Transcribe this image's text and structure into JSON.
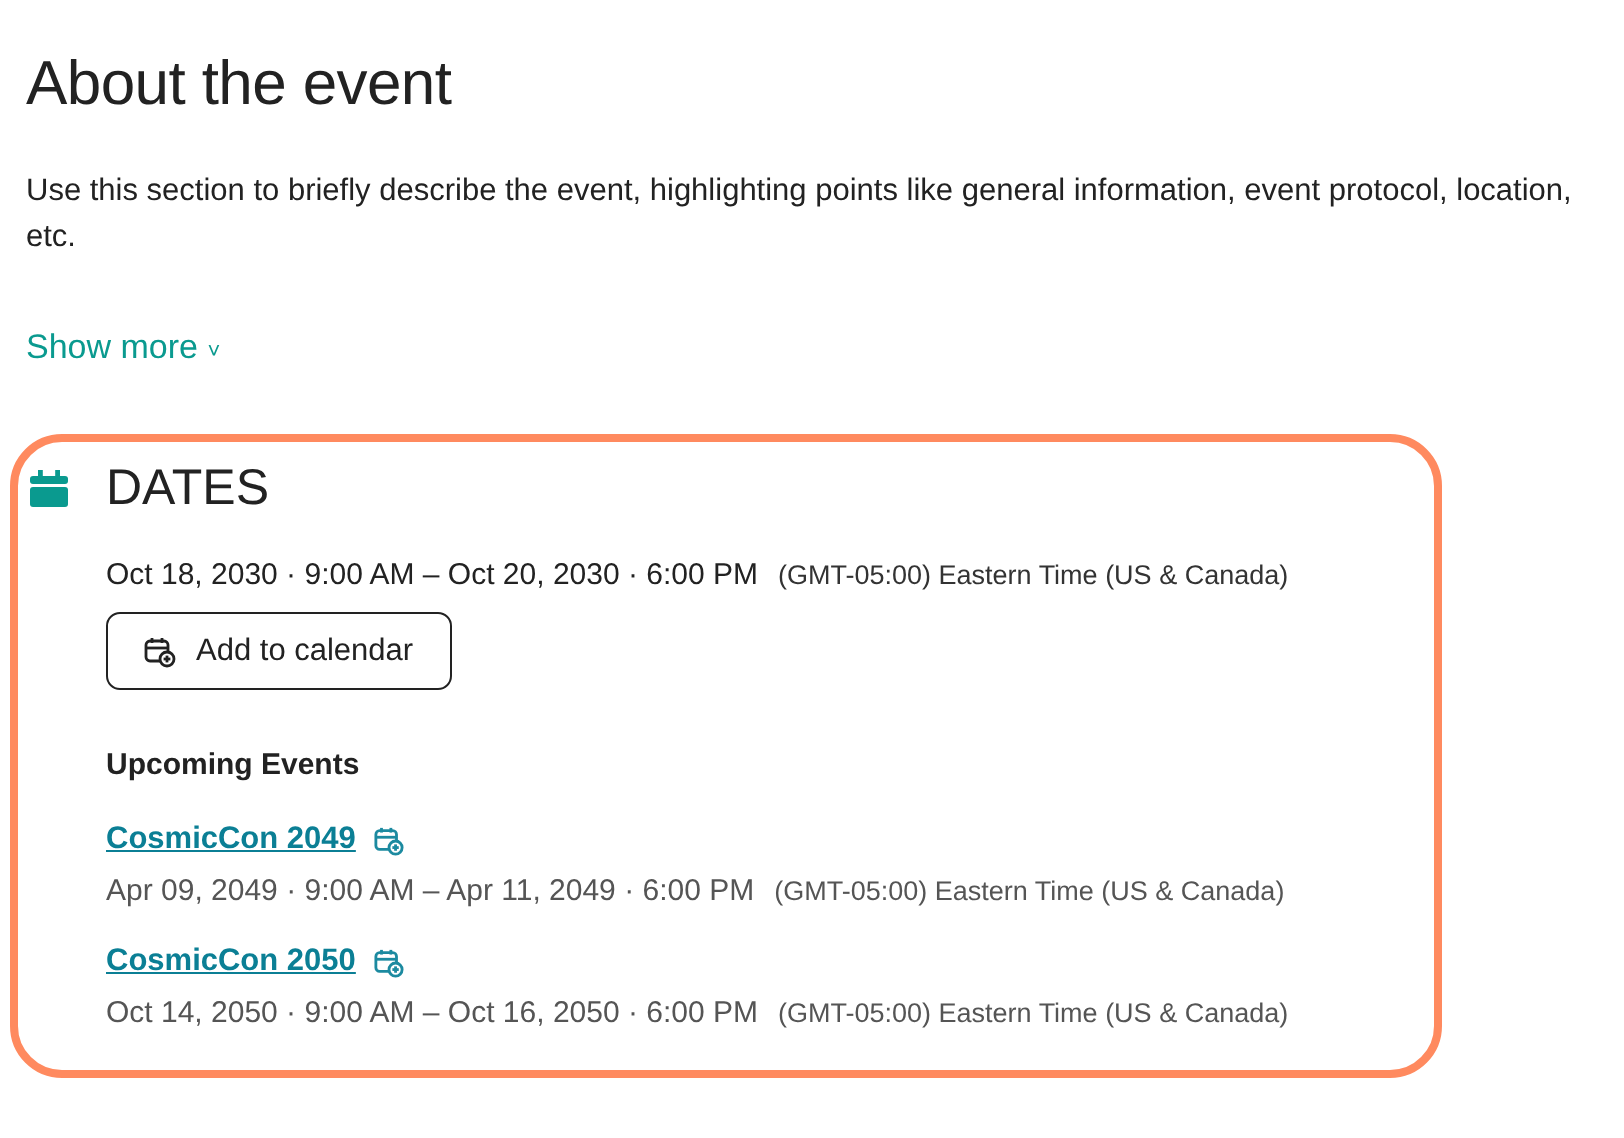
{
  "section": {
    "title": "About the event",
    "description": "Use this section to briefly describe the event, highlighting points like general information, event protocol, location, etc.",
    "show_more": "Show more",
    "show_more_caret": "˅"
  },
  "dates": {
    "title": "DATES",
    "date_range": "Oct 18, 2030 · 9:00 AM – Oct 20, 2030 · 6:00 PM",
    "timezone": "(GMT-05:00) Eastern Time (US & Canada)",
    "add_button": "Add to calendar"
  },
  "upcoming": {
    "title": "Upcoming Events",
    "events": [
      {
        "name": "CosmicCon 2049",
        "date_range": "Apr 09, 2049 · 9:00 AM – Apr 11, 2049 · 6:00 PM",
        "timezone": "(GMT-05:00) Eastern Time (US & Canada)"
      },
      {
        "name": "CosmicCon 2050",
        "date_range": "Oct 14, 2050 · 9:00 AM – Oct 16, 2050 · 6:00 PM",
        "timezone": "(GMT-05:00) Eastern Time (US & Canada)"
      }
    ]
  }
}
